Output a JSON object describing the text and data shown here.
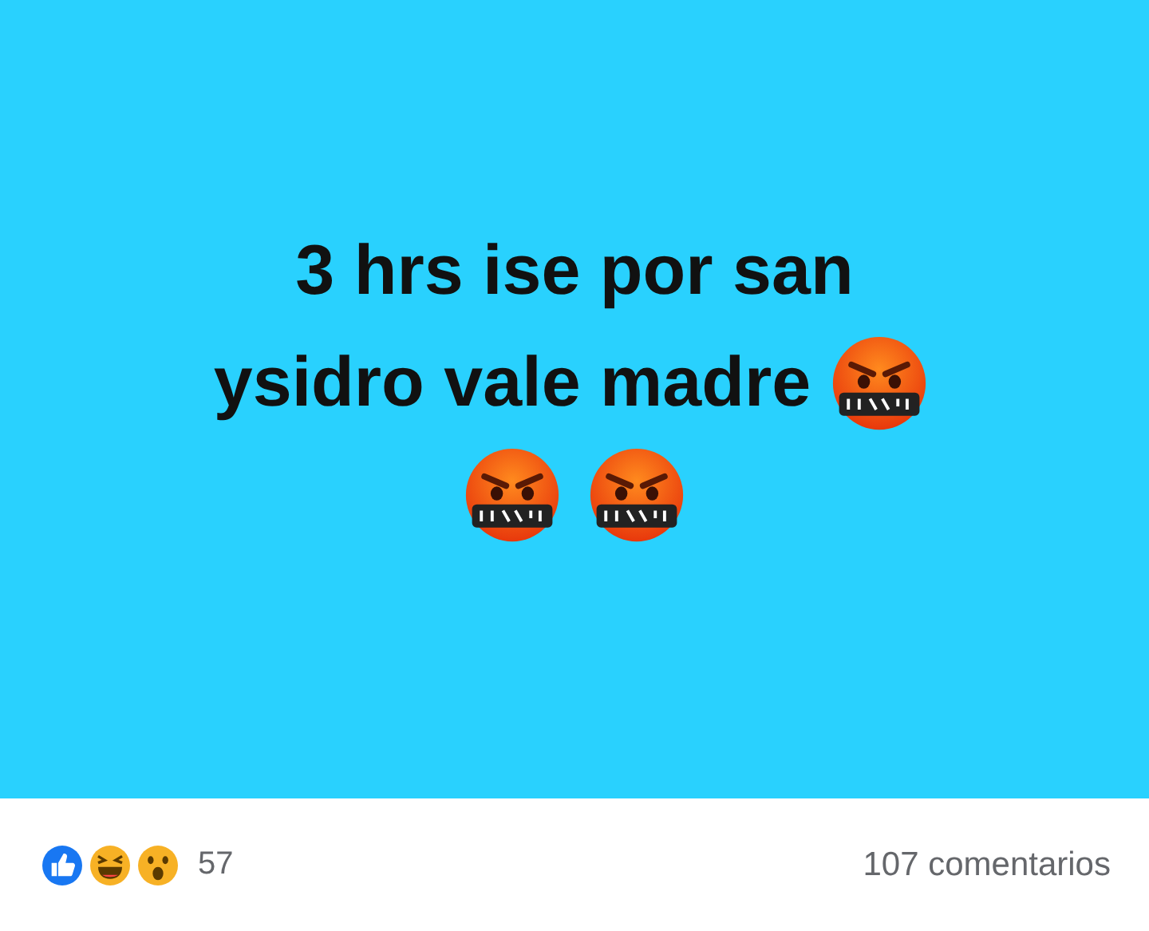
{
  "post": {
    "lines": [
      {
        "text": "3 hrs ise por san"
      },
      {
        "text": "ysidro vale madre",
        "emojis": [
          {
            "kind": "cursing-face"
          }
        ]
      },
      {
        "emojis": [
          {
            "kind": "cursing-face"
          },
          {
            "kind": "cursing-face"
          }
        ]
      }
    ]
  },
  "footer": {
    "reactions": [
      {
        "kind": "like"
      },
      {
        "kind": "haha"
      },
      {
        "kind": "wow"
      }
    ],
    "reaction_count": "57",
    "comments": "107 comentarios"
  }
}
